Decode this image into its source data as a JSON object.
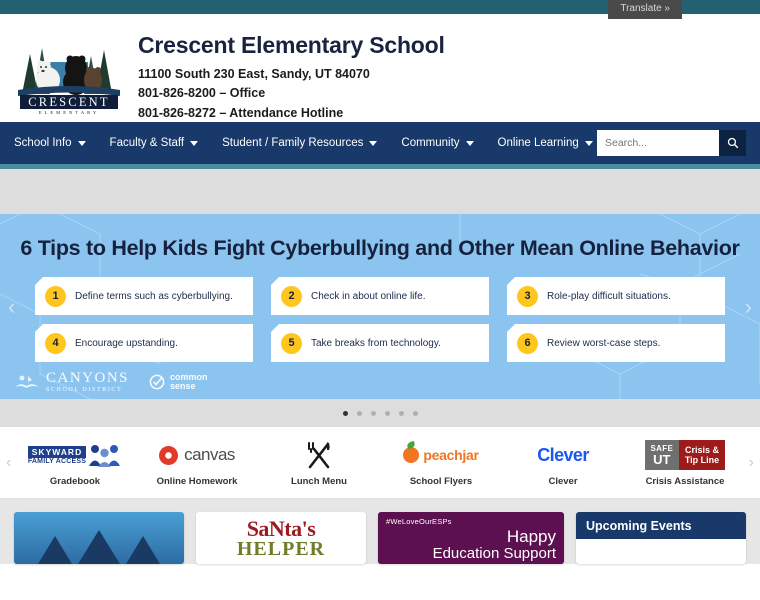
{
  "topbar": {
    "translate_label": "Translate »",
    "bar_color": "#236072"
  },
  "header": {
    "logo_name": "crescent-elementary-logo",
    "logo_word": "CRESCENT",
    "logo_subword": "E L E M E N T A R Y",
    "school_title": "Crescent Elementary School",
    "address": "11100 South 230 East, Sandy, UT 84070",
    "phone_office": "801-826-8200 – Office",
    "phone_attendance": "801-826-8272 – Attendance Hotline"
  },
  "nav": {
    "bg_color": "#183969",
    "items": [
      {
        "label": "School Info",
        "has_caret": true
      },
      {
        "label": "Faculty & Staff",
        "has_caret": true
      },
      {
        "label": "Student / Family Resources",
        "has_caret": true
      },
      {
        "label": "Community",
        "has_caret": true
      },
      {
        "label": "Online Learning",
        "has_caret": true
      }
    ],
    "search_placeholder": "Search...",
    "search_value": ""
  },
  "carousel": {
    "title": "6 Tips to Help Kids Fight Cyberbullying and Other Mean Online Behavior",
    "bg_color": "#8cc4f0",
    "accent_color": "#ffc61e",
    "prev_label": "‹",
    "next_label": "›",
    "tips": [
      {
        "num": "1",
        "text": "Define terms such as cyberbullying."
      },
      {
        "num": "2",
        "text": "Check in about online life."
      },
      {
        "num": "3",
        "text": "Role-play difficult situations."
      },
      {
        "num": "4",
        "text": "Encourage upstanding."
      },
      {
        "num": "5",
        "text": "Take breaks from technology."
      },
      {
        "num": "6",
        "text": "Review worst-case steps."
      }
    ],
    "brands": {
      "canyons_main": "CANYONS",
      "canyons_sub": "SCHOOL DISTRICT",
      "commonsense_line1": "common",
      "commonsense_line2": "sense"
    },
    "dots": [
      {
        "active": true
      },
      {
        "active": false
      },
      {
        "active": false
      },
      {
        "active": false
      },
      {
        "active": false
      },
      {
        "active": false
      }
    ]
  },
  "quicklinks": {
    "prev_label": "‹",
    "next_label": "›",
    "items": [
      {
        "label": "Gradebook",
        "logo": "skyward-family-access-logo",
        "word1": "SKYWARD",
        "word2": "FAMILY ACCESS"
      },
      {
        "label": "Online Homework",
        "logo": "canvas-logo",
        "word1": "canvas"
      },
      {
        "label": "Lunch Menu",
        "logo": "fork-and-knife-icon",
        "word1": "✕"
      },
      {
        "label": "School Flyers",
        "logo": "peachjar-logo",
        "word1": "peachjar"
      },
      {
        "label": "Clever",
        "logo": "clever-logo",
        "word1": "Clever"
      },
      {
        "label": "Crisis Assistance",
        "logo": "safe-ut-crisis-tip-line-logo",
        "word1": "SAFE",
        "word2": "UT",
        "word3": "Crisis &",
        "word4": "Tip Line"
      }
    ]
  },
  "bottom": {
    "cards": [
      {
        "name": "arrows-promo-card",
        "type": "arrows",
        "text": ""
      },
      {
        "name": "santas-helper-card",
        "type": "santa",
        "line1": "SaNta's",
        "line2": "HELPER"
      },
      {
        "name": "esp-appreciation-card",
        "type": "esp",
        "hashtag": "#WeLoveOurESPs",
        "happy": "Happy",
        "sub": "Education Support"
      },
      {
        "name": "upcoming-events-card",
        "type": "events",
        "heading": "Upcoming Events",
        "body": ""
      }
    ]
  }
}
